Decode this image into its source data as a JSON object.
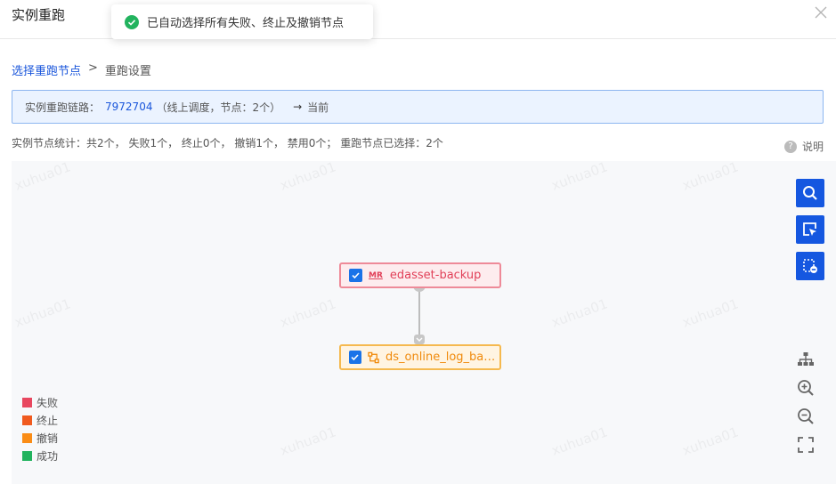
{
  "header": {
    "title": "实例重跑"
  },
  "toast": {
    "message": "已自动选择所有失败、终止及撤销节点"
  },
  "breadcrumb": {
    "step1": "选择重跑节点",
    "separator": ">",
    "step2": "重跑设置"
  },
  "chain": {
    "label": "实例重跑链路：",
    "instance_id": "7972704",
    "detail": "（线上调度，节点：2个）",
    "arrow": "→",
    "current": "当前"
  },
  "stats": {
    "text": "实例节点统计：共2个， 失败1个， 终止0个， 撤销1个， 禁用0个； 重跑节点已选择：2个"
  },
  "help": {
    "label": "说明",
    "icon_glyph": "?"
  },
  "watermark": "xuhua01",
  "nodes": [
    {
      "label": "edasset-backup",
      "badge": "MR",
      "status": "失败",
      "checked": true
    },
    {
      "label": "ds_online_log_back...",
      "status": "撤销",
      "checked": true
    }
  ],
  "legend": [
    {
      "label": "失败",
      "color": "#e8475f"
    },
    {
      "label": "终止",
      "color": "#f05a1e"
    },
    {
      "label": "撤销",
      "color": "#fa8c16"
    },
    {
      "label": "成功",
      "color": "#22b35e"
    }
  ],
  "toolbar_icons": [
    "search-icon",
    "select-pointer-icon",
    "deselect-icon"
  ],
  "graph_tools": [
    "hierarchy-layout-icon",
    "zoom-in-icon",
    "zoom-out-icon",
    "fit-screen-icon"
  ],
  "colors": {
    "primary": "#1557e0",
    "fail": "#e14058",
    "cancel": "#f08a0c"
  }
}
